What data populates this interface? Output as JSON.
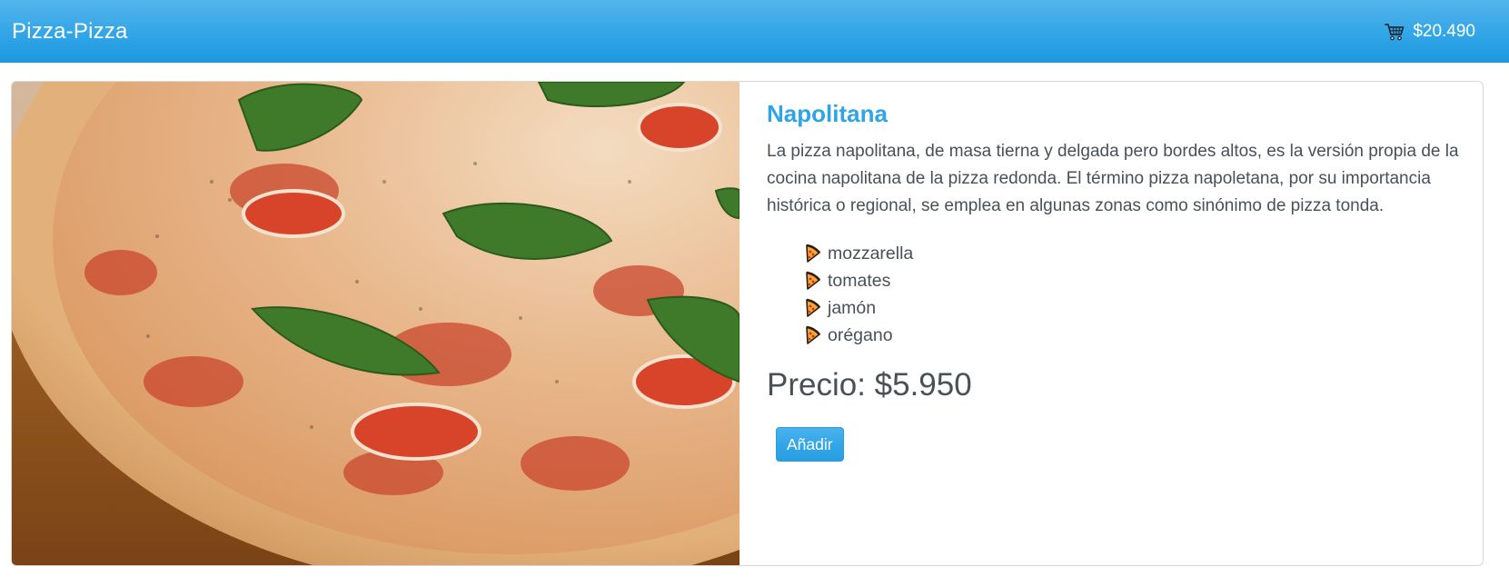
{
  "navbar": {
    "brand": "Pizza-Pizza",
    "cart_icon": "shopping-cart-icon",
    "cart_total": "$20.490"
  },
  "product": {
    "image": "pizza-photo",
    "name": "Napolitana",
    "description": "La pizza napolitana, de masa tierna y delgada pero bordes altos, es la versión propia de la cocina napolitana de la pizza redonda. El término pizza napoletana, por su importancia histórica o regional, se emplea en algunas zonas como sinónimo de pizza tonda.",
    "ingredient_icon": "pizza-slice-icon",
    "ingredients": [
      "mozzarella",
      "tomates",
      "jamón",
      "orégano"
    ],
    "price": "Precio: $5.950",
    "add_button": "Añadir"
  },
  "colors": {
    "primary": "#2fa4e7",
    "text": "#495057"
  }
}
